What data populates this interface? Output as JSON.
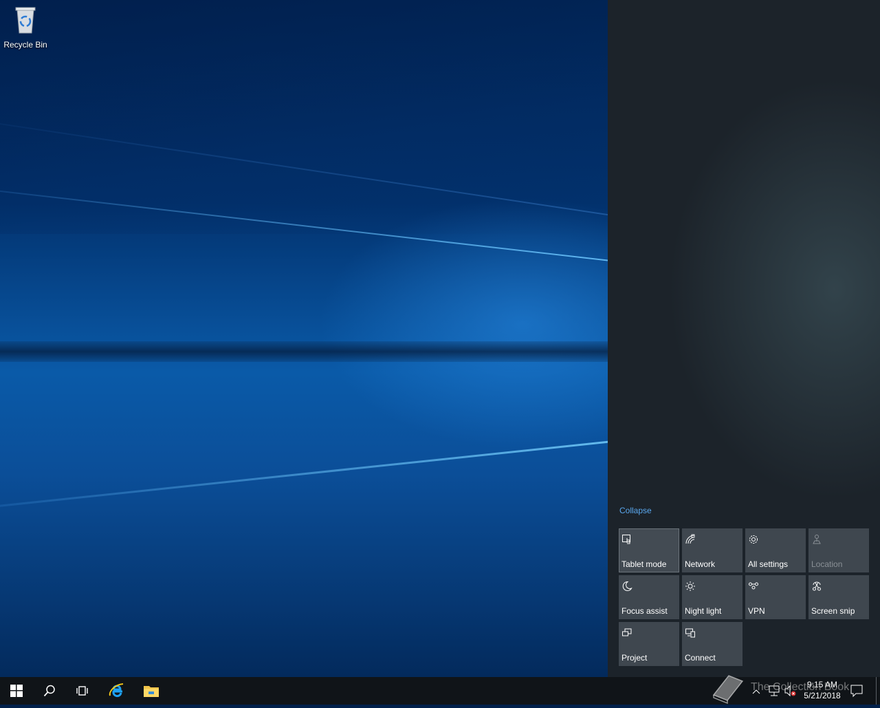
{
  "desktop": {
    "icons": [
      {
        "label": "Recycle Bin",
        "icon": "recycle-bin-icon"
      }
    ]
  },
  "action_center": {
    "collapse_label": "Collapse",
    "tiles": [
      {
        "label": "Tablet mode",
        "icon": "tablet-mode-icon",
        "state": "normal"
      },
      {
        "label": "Network",
        "icon": "network-icon",
        "state": "normal"
      },
      {
        "label": "All settings",
        "icon": "gear-icon",
        "state": "normal"
      },
      {
        "label": "Location",
        "icon": "location-icon",
        "state": "disabled"
      },
      {
        "label": "Focus assist",
        "icon": "moon-icon",
        "state": "normal"
      },
      {
        "label": "Night light",
        "icon": "sun-icon",
        "state": "normal"
      },
      {
        "label": "VPN",
        "icon": "vpn-icon",
        "state": "normal"
      },
      {
        "label": "Screen snip",
        "icon": "screen-snip-icon",
        "state": "normal"
      },
      {
        "label": "Project",
        "icon": "project-icon",
        "state": "normal"
      },
      {
        "label": "Connect",
        "icon": "connect-icon",
        "state": "normal"
      }
    ]
  },
  "taskbar": {
    "clock": {
      "time": "9:15 AM",
      "date": "5/21/2018"
    }
  },
  "watermark": {
    "text": "The Collection Book"
  },
  "colors": {
    "accent": "#5aa8ef",
    "tile_bg": "#3f474f",
    "taskbar_bg": "#101418"
  }
}
